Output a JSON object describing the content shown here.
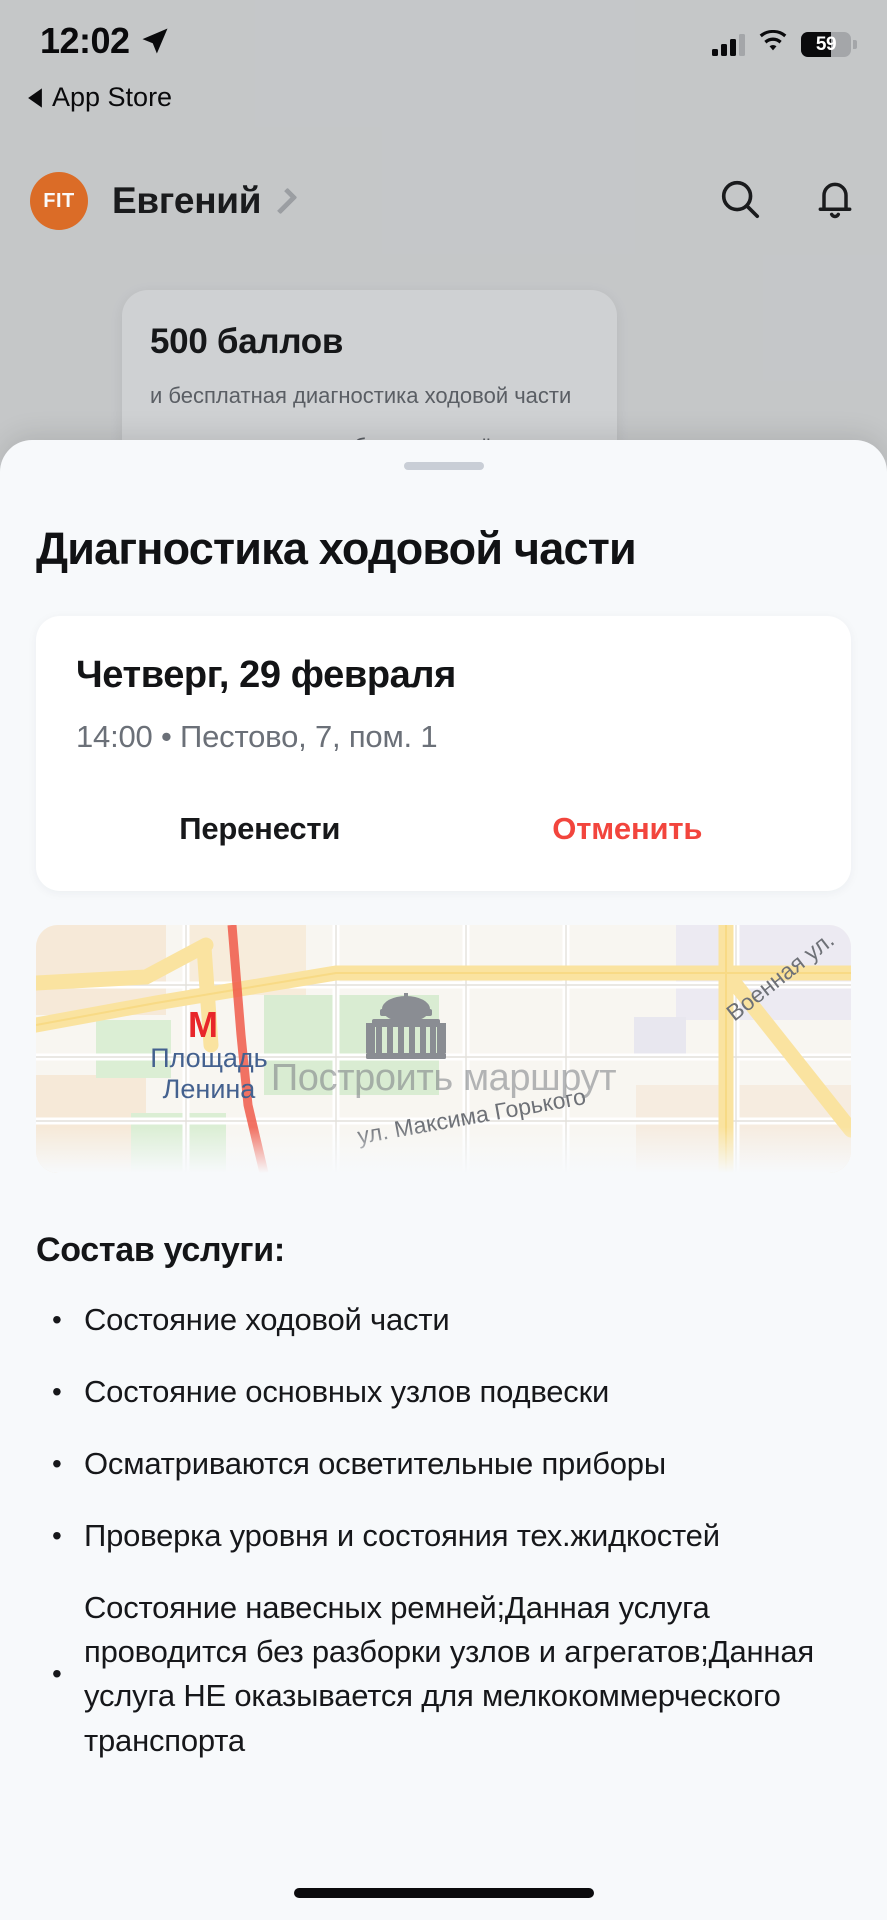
{
  "statusbar": {
    "time": "12:02",
    "location_icon": "location-arrow-icon",
    "cellular_icon": "cellular-bars-icon",
    "wifi_icon": "wifi-icon",
    "battery_percent": "59",
    "battery_fill_ratio": 0.6,
    "back_app_label": "App Store"
  },
  "header": {
    "avatar_text": "FIT",
    "avatar_color": "#e06f28",
    "username": "Евгений",
    "chevron_icon": "chevron-right-icon",
    "search_icon": "search-icon",
    "bell_icon": "bell-icon"
  },
  "bonus_card": {
    "title": "500 баллов",
    "line1": "и бесплатная диагностика ходовой части",
    "line2": "появятся на вашем бонусном счёте"
  },
  "sheet": {
    "title": "Диагностика ходовой части",
    "appointment": {
      "date": "Четверг, 29 февраля",
      "meta": "14:00 • Пестово, 7, пом. 1",
      "reschedule_label": "Перенести",
      "cancel_label": "Отменить",
      "cancel_color": "#f2453d"
    },
    "map": {
      "route_overlay": "Построить маршрут",
      "metro_label": "Площадь\nЛенина",
      "metro_label_line1": "Площадь",
      "metro_label_line2": "Ленина",
      "metro_glyph": "М",
      "metro_color": "#e8262a",
      "street_gorky": "ул. Максима Горького",
      "street_voennaya": "Военная ул.",
      "landmark_icon": "government-building-icon"
    },
    "composition": {
      "title": "Состав услуги:",
      "items": [
        "Состояние ходовой части",
        "Состояние основных узлов подвески",
        "Осматриваются осветительные приборы",
        "Проверка уровня и состояния тех.жидкостей",
        "Состояние навесных ремней;Данная услуга проводится без разборки узлов и агрегатов;Данная услуга НЕ оказывается для мелкокоммерческого транспорта"
      ]
    }
  },
  "home_indicator": "home-indicator"
}
